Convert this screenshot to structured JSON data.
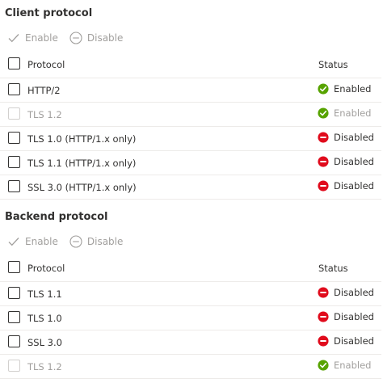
{
  "colors": {
    "enabled": "#57a300",
    "disabled": "#e00b1c",
    "muted_text": "#a19f9d",
    "text": "#323130"
  },
  "client": {
    "title": "Client protocol",
    "toolbar": {
      "enable_label": "Enable",
      "disable_label": "Disable"
    },
    "header": {
      "protocol": "Protocol",
      "status": "Status"
    },
    "rows": [
      {
        "protocol": "HTTP/2",
        "status": "Enabled"
      },
      {
        "protocol": "TLS 1.2",
        "status": "Enabled"
      },
      {
        "protocol": "TLS 1.0 (HTTP/1.x only)",
        "status": "Disabled"
      },
      {
        "protocol": "TLS 1.1 (HTTP/1.x only)",
        "status": "Disabled"
      },
      {
        "protocol": "SSL 3.0 (HTTP/1.x only)",
        "status": "Disabled"
      }
    ]
  },
  "backend": {
    "title": "Backend protocol",
    "toolbar": {
      "enable_label": "Enable",
      "disable_label": "Disable"
    },
    "header": {
      "protocol": "Protocol",
      "status": "Status"
    },
    "rows": [
      {
        "protocol": "TLS 1.1",
        "status": "Disabled"
      },
      {
        "protocol": "TLS 1.0",
        "status": "Disabled"
      },
      {
        "protocol": "SSL 3.0",
        "status": "Disabled"
      },
      {
        "protocol": "TLS 1.2",
        "status": "Enabled"
      }
    ]
  }
}
